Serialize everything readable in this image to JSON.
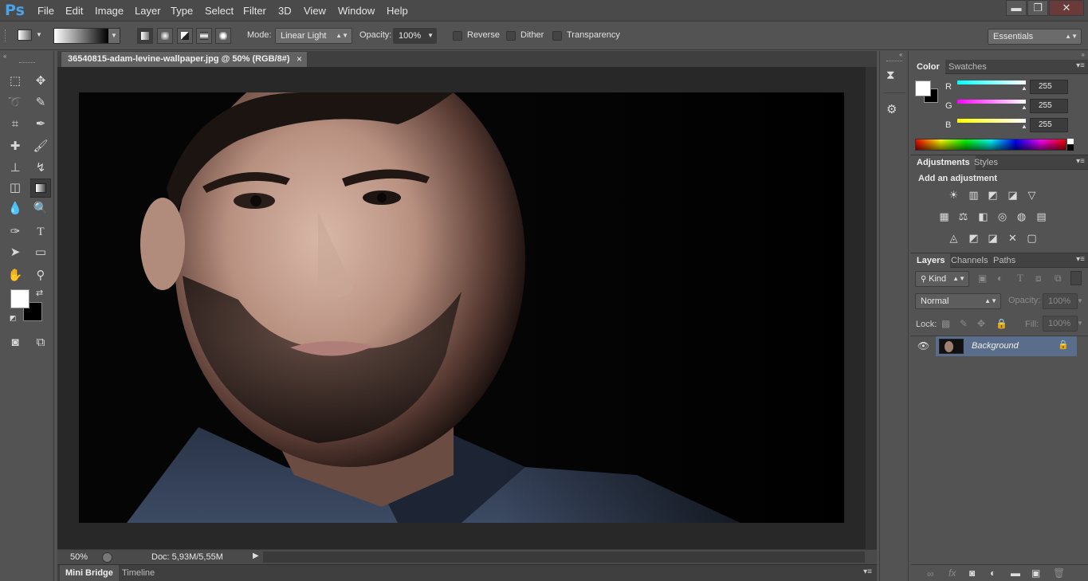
{
  "app": {
    "logo": "Ps"
  },
  "menu": [
    "File",
    "Edit",
    "Image",
    "Layer",
    "Type",
    "Select",
    "Filter",
    "3D",
    "View",
    "Window",
    "Help"
  ],
  "window_controls": {
    "minimize": "▬",
    "restore": "❐",
    "close": "✕"
  },
  "options": {
    "mode_label": "Mode:",
    "mode_value": "Linear Light",
    "opacity_label": "Opacity:",
    "opacity_value": "100%",
    "reverse_label": "Reverse",
    "dither_label": "Dither",
    "transparency_label": "Transparency",
    "workspace": "Essentials"
  },
  "document": {
    "tab_title": "36540815-adam-levine-wallpaper.jpg @ 50% (RGB/8#)",
    "tab_close": "×",
    "zoom": "50%",
    "doc_info": "Doc: 5,93M/5,55M"
  },
  "bottom_tabs": [
    "Mini Bridge",
    "Timeline"
  ],
  "color_panel": {
    "tabs": [
      "Color",
      "Swatches"
    ],
    "channels": [
      {
        "label": "R",
        "value": "255",
        "gradient": "linear-gradient(90deg,#00ffff,#ffffff)"
      },
      {
        "label": "G",
        "value": "255",
        "gradient": "linear-gradient(90deg,#ff00ff,#ffffff)"
      },
      {
        "label": "B",
        "value": "255",
        "gradient": "linear-gradient(90deg,#ffff00,#ffffff)"
      }
    ]
  },
  "adjustments_panel": {
    "tabs": [
      "Adjustments",
      "Styles"
    ],
    "heading": "Add an adjustment",
    "row1": [
      "☀",
      "▥",
      "◩",
      "◪",
      "▽"
    ],
    "row2": [
      "▦",
      "⚖",
      "◧",
      "◎",
      "◍",
      "▤"
    ],
    "row3": [
      "◬",
      "◩",
      "◪",
      "✕",
      "▢"
    ]
  },
  "layers_panel": {
    "tabs": [
      "Layers",
      "Channels",
      "Paths"
    ],
    "filter_kind": "Kind",
    "blend_mode": "Normal",
    "opacity_label": "Opacity:",
    "opacity_value": "100%",
    "lock_label": "Lock:",
    "fill_label": "Fill:",
    "fill_value": "100%",
    "layers": [
      {
        "name": "Background",
        "visible": true,
        "locked": true
      }
    ],
    "footer_icons": [
      "∞",
      "fx",
      "◙",
      "◐",
      "▬",
      "▣",
      "🗑"
    ]
  },
  "colors": {
    "foreground": "#ffffff",
    "background": "#000000",
    "selected_layer": "#5a6d8a",
    "accent": "#4aa3e8"
  }
}
